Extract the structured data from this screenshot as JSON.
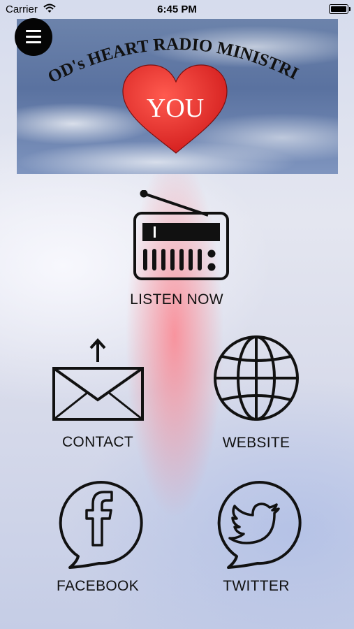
{
  "status_bar": {
    "carrier": "Carrier",
    "time": "6:45 PM"
  },
  "banner": {
    "title": "GOD's HEART RADIO MINISTRIES",
    "heart_text": "YOU"
  },
  "menu": {
    "icon": "hamburger-menu-icon"
  },
  "tiles": {
    "listen": {
      "label": "LISTEN NOW",
      "icon": "radio-icon"
    },
    "contact": {
      "label": "CONTACT",
      "icon": "mail-send-icon"
    },
    "website": {
      "label": "WEBSITE",
      "icon": "globe-icon"
    },
    "facebook": {
      "label": "FACEBOOK",
      "icon": "facebook-bubble-icon"
    },
    "twitter": {
      "label": "TWITTER",
      "icon": "twitter-bubble-icon"
    }
  },
  "colors": {
    "heart": "#e32b2b",
    "icon_stroke": "#111111",
    "menu_bg": "#050505"
  }
}
